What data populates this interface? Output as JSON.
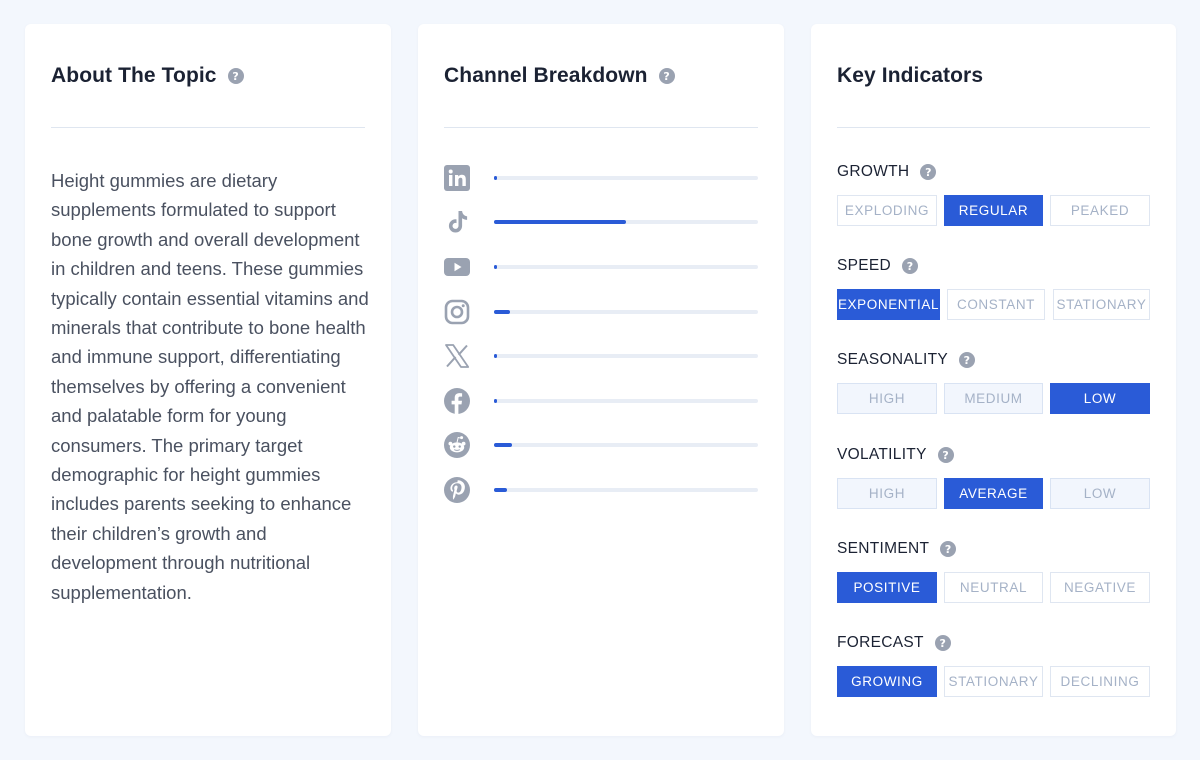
{
  "about": {
    "title": "About The Topic",
    "text": "Height gummies are dietary supplements formulated to support bone growth and overall development in children and teens. These gummies typically contain essential vitamins and minerals that contribute to bone health and immune support, differentiating themselves by offering a convenient and palatable form for young consumers. The primary target demographic for height gummies includes parents seeking to enhance their children’s growth and development through nutritional supplementation."
  },
  "channels": {
    "title": "Channel Breakdown",
    "items": [
      {
        "icon": "linkedin-icon",
        "share": 0.01
      },
      {
        "icon": "tiktok-icon",
        "share": 0.5
      },
      {
        "icon": "youtube-icon",
        "share": 0.01
      },
      {
        "icon": "instagram-icon",
        "share": 0.06
      },
      {
        "icon": "x-icon",
        "share": 0.01
      },
      {
        "icon": "facebook-icon",
        "share": 0.01
      },
      {
        "icon": "reddit-icon",
        "share": 0.07
      },
      {
        "icon": "pinterest-icon",
        "share": 0.05
      }
    ]
  },
  "indicators": {
    "title": "Key Indicators",
    "growth": {
      "label": "GROWTH",
      "options": [
        "EXPLODING",
        "REGULAR",
        "PEAKED"
      ],
      "selected": "REGULAR"
    },
    "speed": {
      "label": "SPEED",
      "options": [
        "EXPONENTIAL",
        "CONSTANT",
        "STATIONARY"
      ],
      "selected": "EXPONENTIAL"
    },
    "seasonality": {
      "label": "SEASONALITY",
      "options": [
        "HIGH",
        "MEDIUM",
        "LOW"
      ],
      "selected": "LOW"
    },
    "volatility": {
      "label": "VOLATILITY",
      "options": [
        "HIGH",
        "AVERAGE",
        "LOW"
      ],
      "selected": "AVERAGE"
    },
    "sentiment": {
      "label": "SENTIMENT",
      "options": [
        "POSITIVE",
        "NEUTRAL",
        "NEGATIVE"
      ],
      "selected": "POSITIVE"
    },
    "forecast": {
      "label": "FORECAST",
      "options": [
        "GROWING",
        "STATIONARY",
        "DECLINING"
      ],
      "selected": "GROWING"
    }
  },
  "colors": {
    "accent": "#2a5bd7",
    "track": "#e8edf5",
    "icon_gray": "#9aa2b1",
    "background": "#f3f7fd"
  }
}
